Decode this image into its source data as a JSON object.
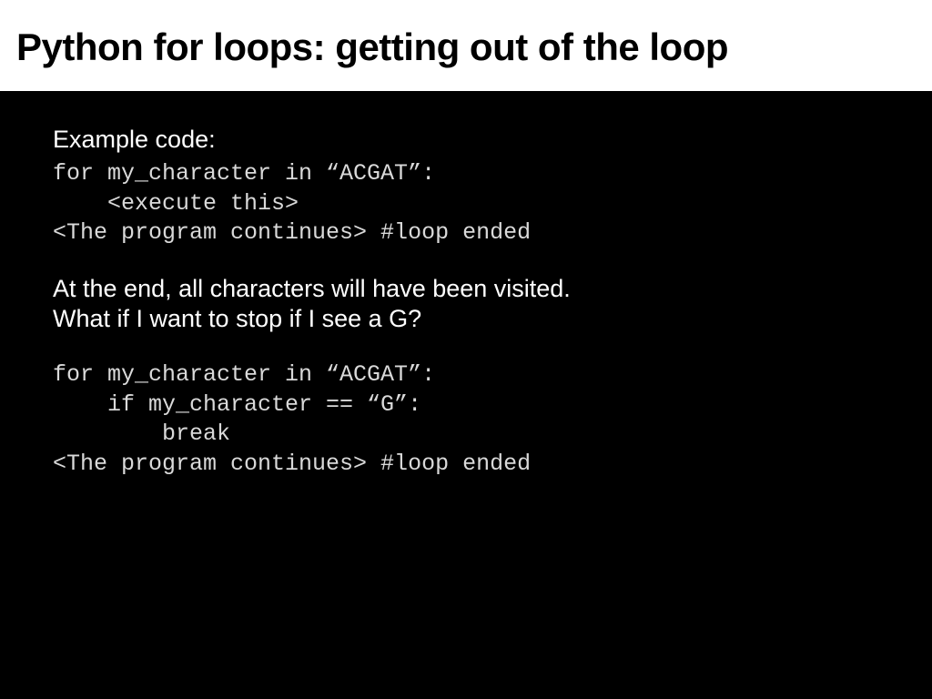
{
  "header": {
    "title": "Python for loops: getting out of the loop"
  },
  "content": {
    "example_label": "Example code:",
    "code1": "for my_character in “ACGAT”:\n    <execute this>\n<The program continues> #loop ended",
    "para1": "At the end, all characters will have been visited.\nWhat if I want to stop if I see a G?",
    "code2": "for my_character in “ACGAT”:\n    if my_character == “G”:\n        break\n<The program continues> #loop ended"
  }
}
